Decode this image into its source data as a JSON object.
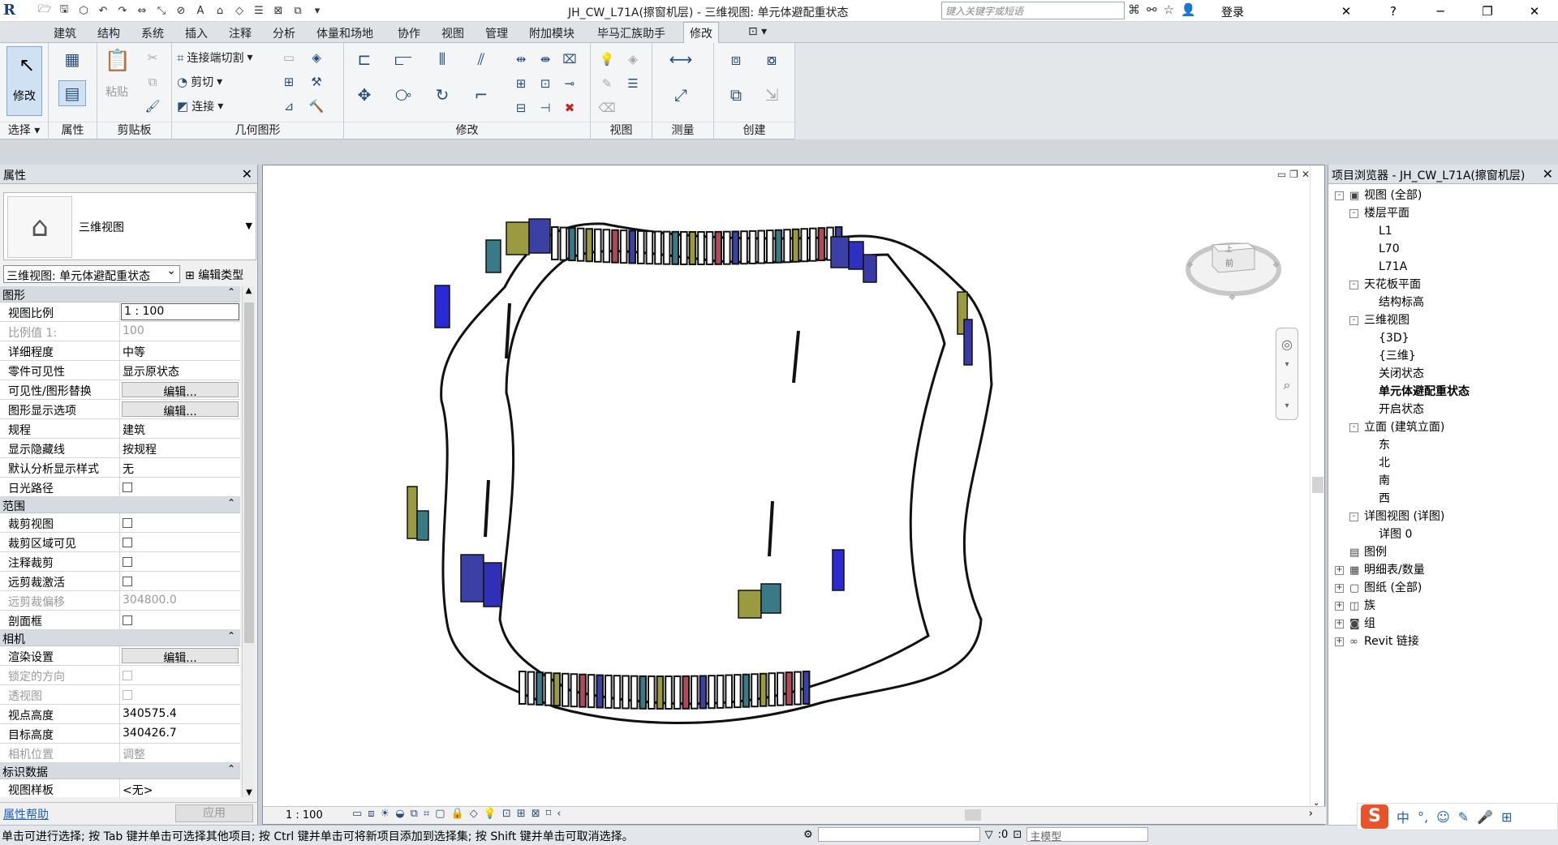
{
  "titlebar": {
    "app_logo": "R",
    "doc_title": "JH_CW_L71A(擦窗机层) - 三维视图: 单元体避配重状态",
    "search_placeholder": "键入关键字或短语",
    "login": "登录"
  },
  "ribbon_tabs": [
    "建筑",
    "结构",
    "系统",
    "插入",
    "注释",
    "分析",
    "体量和场地",
    "协作",
    "视图",
    "管理",
    "附加模块",
    "毕马汇族助手",
    "修改"
  ],
  "ribbon_active_tab": "修改",
  "ribbon": {
    "modify_label": "修改",
    "paste_label": "粘贴",
    "geometry": {
      "cope": "连接端切割",
      "cut": "剪切",
      "join": "连接"
    },
    "groups": [
      "选择",
      "属性",
      "剪贴板",
      "几何图形",
      "修改",
      "视图",
      "测量",
      "创建"
    ]
  },
  "properties": {
    "title": "属性",
    "type_name": "三维视图",
    "instance_selector": "三维视图: 单元体避配重状态",
    "edit_type": "编辑类型",
    "sections": [
      {
        "name": "图形",
        "rows": [
          {
            "name": "视图比例",
            "value": "1 : 100",
            "kind": "boxed"
          },
          {
            "name": "比例值 1:",
            "value": "100",
            "kind": "dim"
          },
          {
            "name": "详细程度",
            "value": "中等"
          },
          {
            "name": "零件可见性",
            "value": "显示原状态"
          },
          {
            "name": "可见性/图形替换",
            "value": "编辑...",
            "kind": "btn"
          },
          {
            "name": "图形显示选项",
            "value": "编辑...",
            "kind": "btn"
          },
          {
            "name": "规程",
            "value": "建筑"
          },
          {
            "name": "显示隐藏线",
            "value": "按规程"
          },
          {
            "name": "默认分析显示样式",
            "value": "无"
          },
          {
            "name": "日光路径",
            "value": "",
            "kind": "check"
          }
        ]
      },
      {
        "name": "范围",
        "rows": [
          {
            "name": "裁剪视图",
            "value": "",
            "kind": "check"
          },
          {
            "name": "裁剪区域可见",
            "value": "",
            "kind": "check"
          },
          {
            "name": "注释裁剪",
            "value": "",
            "kind": "check"
          },
          {
            "name": "远剪裁激活",
            "value": "",
            "kind": "check"
          },
          {
            "name": "远剪裁偏移",
            "value": "304800.0",
            "kind": "dim"
          },
          {
            "name": "剖面框",
            "value": "",
            "kind": "check"
          }
        ]
      },
      {
        "name": "相机",
        "rows": [
          {
            "name": "渲染设置",
            "value": "编辑...",
            "kind": "btn"
          },
          {
            "name": "锁定的方向",
            "value": "",
            "kind": "dimcheck"
          },
          {
            "name": "透视图",
            "value": "",
            "kind": "dimcheck"
          },
          {
            "name": "视点高度",
            "value": "340575.4"
          },
          {
            "name": "目标高度",
            "value": "340426.7"
          },
          {
            "name": "相机位置",
            "value": "调整",
            "kind": "dim"
          }
        ]
      },
      {
        "name": "标识数据",
        "rows": [
          {
            "name": "视图样板",
            "value": "<无>"
          }
        ]
      }
    ],
    "help_link": "属性帮助",
    "apply": "应用"
  },
  "viewport": {
    "scale": "1 : 100",
    "viewcube_top": "上",
    "viewcube_front": "前"
  },
  "browser": {
    "title": "项目浏览器 - JH_CW_L71A(擦窗机层)",
    "nodes": [
      {
        "label": "视图 (全部)",
        "level": 0,
        "toggle": "-",
        "icon": "▣"
      },
      {
        "label": "楼层平面",
        "level": 1,
        "toggle": "-"
      },
      {
        "label": "L1",
        "level": 2
      },
      {
        "label": "L70",
        "level": 2
      },
      {
        "label": "L71A",
        "level": 2
      },
      {
        "label": "天花板平面",
        "level": 1,
        "toggle": "-"
      },
      {
        "label": "结构标高",
        "level": 2
      },
      {
        "label": "三维视图",
        "level": 1,
        "toggle": "-"
      },
      {
        "label": "{3D}",
        "level": 2
      },
      {
        "label": "{三维}",
        "level": 2
      },
      {
        "label": "关闭状态",
        "level": 2
      },
      {
        "label": "单元体避配重状态",
        "level": 2,
        "selected": true
      },
      {
        "label": "开启状态",
        "level": 2
      },
      {
        "label": "立面 (建筑立面)",
        "level": 1,
        "toggle": "-"
      },
      {
        "label": "东",
        "level": 2
      },
      {
        "label": "北",
        "level": 2
      },
      {
        "label": "南",
        "level": 2
      },
      {
        "label": "西",
        "level": 2
      },
      {
        "label": "详图视图 (详图)",
        "level": 1,
        "toggle": "-"
      },
      {
        "label": "详图 0",
        "level": 2
      },
      {
        "label": "图例",
        "level": 0,
        "icon": "▤"
      },
      {
        "label": "明细表/数量",
        "level": 0,
        "toggle": "+",
        "icon": "▦"
      },
      {
        "label": "图纸 (全部)",
        "level": 0,
        "toggle": "+",
        "icon": "▢"
      },
      {
        "label": "族",
        "level": 0,
        "toggle": "+",
        "icon": "◫"
      },
      {
        "label": "组",
        "level": 0,
        "toggle": "+",
        "icon": "◙"
      },
      {
        "label": "Revit 链接",
        "level": 0,
        "toggle": "+",
        "icon": "∞"
      }
    ]
  },
  "status": {
    "text": "单击可进行选择; 按 Tab 键并单击可选择其他项目; 按 Ctrl 键并单击可将新项目添加到选择集; 按 Shift 键并单击可取消选择。",
    "zero": ":0",
    "model": "主模型"
  },
  "ime": {
    "logo": "S",
    "mode": "中"
  }
}
